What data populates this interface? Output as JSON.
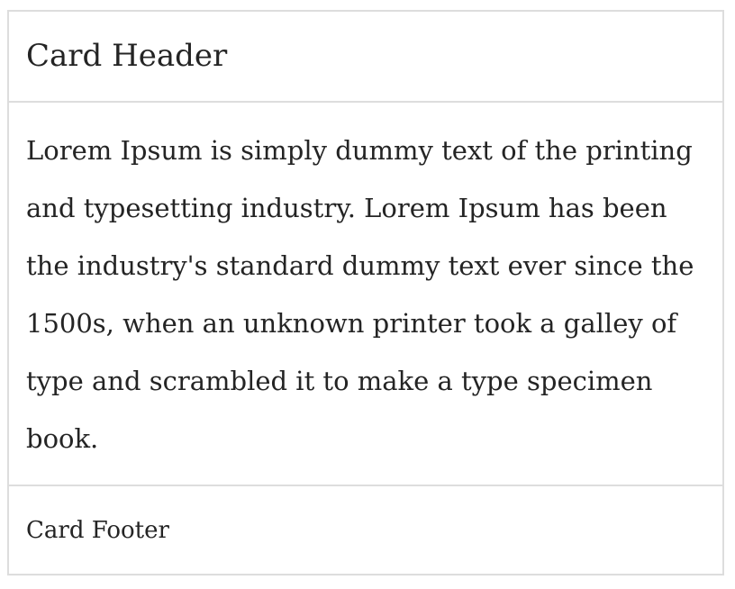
{
  "card": {
    "header": "Card Header",
    "body_lines": [
      "Lorem Ipsum is simply dummy text of the printing",
      "and typesetting industry. Lorem Ipsum has been",
      "the industry's standard dummy text ever since the",
      "1500s, when an unknown printer took a galley of",
      "type and scrambled it to make a type specimen",
      "book."
    ],
    "footer": "Card Footer"
  },
  "colors": {
    "border": "#dddddd",
    "text": "#242424",
    "background": "#ffffff"
  }
}
